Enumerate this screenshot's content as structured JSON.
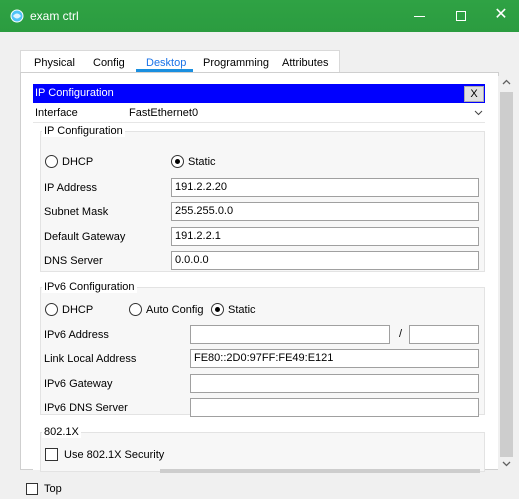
{
  "window": {
    "title": "exam ctrl",
    "controls": {
      "minimize": "–",
      "maximize": "☐",
      "close": "✕"
    }
  },
  "tabs": [
    {
      "label": "Physical",
      "active": false
    },
    {
      "label": "Config",
      "active": false
    },
    {
      "label": "Desktop",
      "active": true
    },
    {
      "label": "Programming",
      "active": false
    },
    {
      "label": "Attributes",
      "active": false
    }
  ],
  "ip_config_window": {
    "title": "IP Configuration",
    "close_label": "X",
    "interface_label": "Interface",
    "interface_value": "FastEthernet0",
    "ipv4": {
      "group_title": "IP Configuration",
      "dhcp_label": "DHCP",
      "static_label": "Static",
      "mode": "Static",
      "ip_address_label": "IP Address",
      "ip_address": "191.2.2.20",
      "subnet_mask_label": "Subnet Mask",
      "subnet_mask": "255.255.0.0",
      "gateway_label": "Default Gateway",
      "gateway": "191.2.2.1",
      "dns_label": "DNS Server",
      "dns": "0.0.0.0"
    },
    "ipv6": {
      "group_title": "IPv6 Configuration",
      "dhcp_label": "DHCP",
      "auto_label": "Auto Config",
      "static_label": "Static",
      "mode": "Static",
      "address_label": "IPv6 Address",
      "address": "",
      "prefix_separator": "/",
      "prefix": "",
      "link_local_label": "Link Local Address",
      "link_local": "FE80::2D0:97FF:FE49:E121",
      "gateway_label": "IPv6 Gateway",
      "gateway": "",
      "dns_label": "IPv6 DNS Server",
      "dns": ""
    },
    "dot1x": {
      "group_title": "802.1X",
      "use_security_label": "Use 802.1X Security"
    }
  },
  "footer": {
    "top_label": "Top"
  },
  "colors": {
    "titlebar": "#2ea043",
    "ipbar": "#0000ff",
    "active_tab": "#1a73e8"
  }
}
